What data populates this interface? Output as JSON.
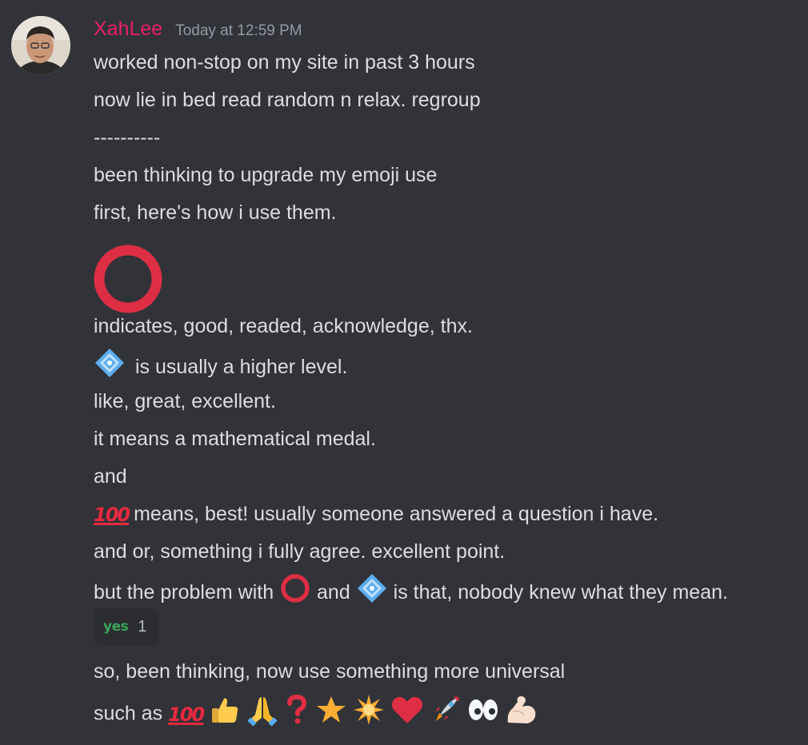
{
  "message": {
    "username": "XahLee",
    "timestamp": "Today at 12:59 PM",
    "lines": {
      "l1": "worked non-stop on my site in past 3 hours",
      "l2": "now lie in bed read random n relax. regroup",
      "l3": "----------",
      "l4": "been thinking to upgrade my emoji use",
      "l5": "first, here's how i use them.",
      "l6": "indicates, good, readed, acknowledge, thx.",
      "l7": "is usually a higher level.",
      "l8": "like, great, excellent.",
      "l9": "it means a mathematical medal.",
      "l10": "and",
      "l11": "means, best! usually someone answered a question i have.",
      "l12": "and or, something i fully agree. excellent point.",
      "l13a": "but the problem with",
      "l13b": "and",
      "l13c": "is that, nobody knew what they mean.",
      "l14": "so, been thinking, now use something more universal",
      "l15": "such as"
    },
    "reaction": {
      "label": "yes",
      "count": "1"
    },
    "hundred_emoji_text": "100"
  },
  "icons": {
    "big_circle": "heavy-large-circle-icon",
    "diamond": "diamond-with-dot-icon",
    "hundred": "hundred-points-icon",
    "emoji_row": [
      "hundred-points-icon",
      "thumbs-up-icon",
      "folded-hands-icon",
      "question-mark-icon",
      "star-icon",
      "glowing-star-icon",
      "red-heart-icon",
      "rocket-icon",
      "eyes-icon",
      "flexed-biceps-icon"
    ]
  },
  "colors": {
    "background": "#313338",
    "username": "#e91e63",
    "text": "#dbdee1",
    "timestamp": "#949ba4",
    "emoji_red": "#dd2e44",
    "reaction_bg": "#2b2d31"
  }
}
